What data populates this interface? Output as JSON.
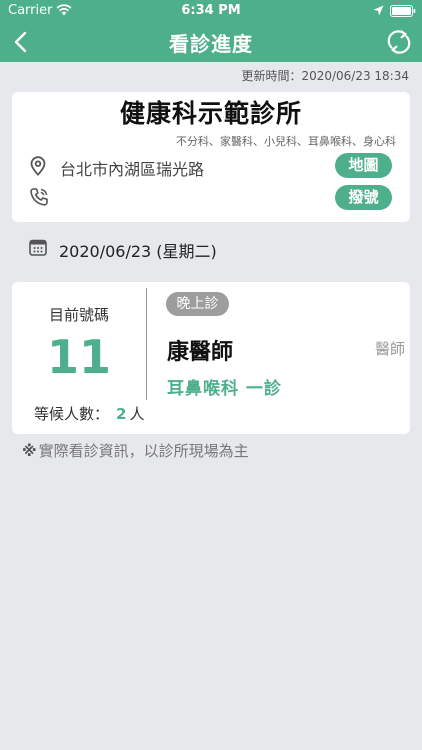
{
  "status_bar": {
    "carrier": "Carrier",
    "time": "6:34 PM",
    "icons": [
      "wifi-icon",
      "location-icon",
      "battery-icon"
    ]
  },
  "nav": {
    "title": "看診進度",
    "back_icon": "chevron-left-icon",
    "refresh_icon": "refresh-icon"
  },
  "update_time": "更新時間：2020/06/23 18:34",
  "clinic": {
    "name": "健康科示範診所",
    "departments": "不分科、家醫科、小兒科、耳鼻喉科、身心科",
    "address": "台北市內湖區瑞光路",
    "map_label": "地圖",
    "call_label": "撥號"
  },
  "date": "2020/06/23 (星期二)",
  "progress": {
    "current_label": "目前號碼",
    "current_number": "11",
    "waiting_label": "等候人數：",
    "waiting_count": "2",
    "waiting_unit": "人",
    "session": "晚上診",
    "doctor_name": "康醫師",
    "doctor_title": "醫師",
    "room": "耳鼻喉科 一診"
  },
  "note": {
    "mark": "※",
    "text": "實際看診資訊，以診所現場為主"
  },
  "colors": {
    "accent": "#4eaf8b",
    "background": "#e6e8ec",
    "badge": "#9d9d9d"
  }
}
